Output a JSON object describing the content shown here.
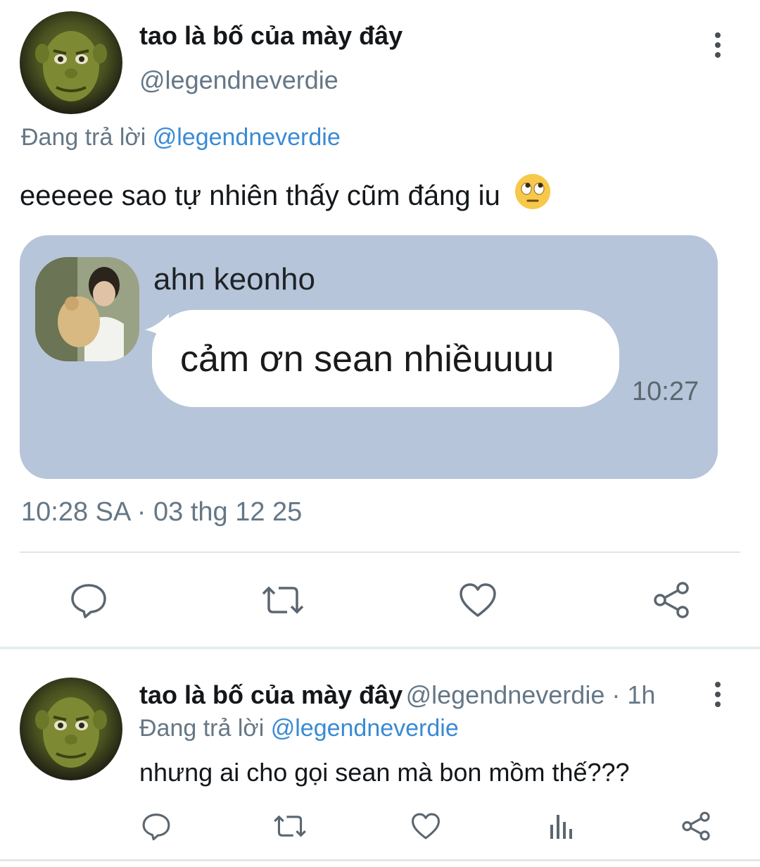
{
  "main_tweet": {
    "display_name": "tao là bố của mày đây",
    "handle": "@legendneverdie",
    "reply_prefix": "Đang trả lời",
    "reply_to": "@legendneverdie",
    "text": "eeeeee sao tự nhiên thấy cũm đáng iu",
    "emoji": "face-with-rolling-eyes",
    "meta": "10:28 SA · 03 thg 12 25",
    "attachment": {
      "sender_name": "ahn keonho",
      "message": "cảm ơn sean nhiềuuuu",
      "time": "10:27",
      "card_color": "#b6c5d9"
    },
    "actions": [
      "reply-icon",
      "retweet-icon",
      "like-icon",
      "share-icon"
    ]
  },
  "reply_tweet": {
    "display_name": "tao là bố của mày đây",
    "handle_time": "@legendneverdie · 1h",
    "reply_prefix": "Đang trả lời",
    "reply_to": "@legendneverdie",
    "text": "nhưng ai cho gọi sean mà bon mồm thế???",
    "actions": [
      "reply-icon",
      "retweet-icon",
      "like-icon",
      "analytics-icon",
      "share-icon"
    ]
  },
  "colors": {
    "secondary_text": "#657786",
    "mention": "#3a8ad4",
    "divider": "#e1e6ea"
  }
}
